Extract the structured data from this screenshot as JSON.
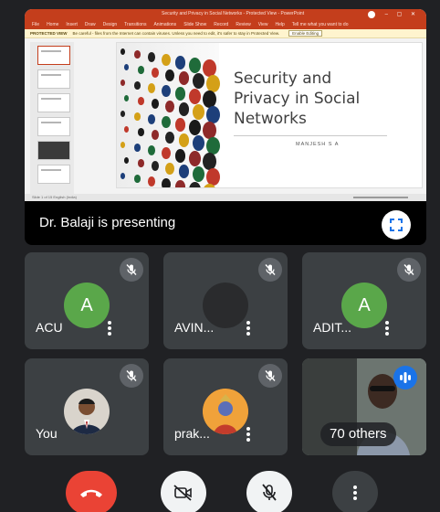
{
  "powerpoint": {
    "window_title": "Security and Privacy in Social Networks - Protected View - PowerPoint",
    "ribbon_tabs": [
      "File",
      "Home",
      "Insert",
      "Draw",
      "Design",
      "Transitions",
      "Animations",
      "Slide Show",
      "Record",
      "Review",
      "View",
      "Help",
      "Tell me what you want to do"
    ],
    "protected_view_label": "PROTECTED VIEW",
    "protected_view_text": "Be careful - files from the Internet can contain viruses. Unless you need to edit, it's safer to stay in Protected View.",
    "enable_editing_label": "Enable Editing",
    "status_text": "Slide 1 of 15   English (India)",
    "slide": {
      "title": "Security and\nPrivacy in Social\nNetworks",
      "author": "MANJESH S A"
    }
  },
  "presenter_banner": "Dr. Balaji is presenting",
  "tiles": [
    {
      "name": "ACU",
      "initial": "A",
      "avatar_color": "#5aa74a"
    },
    {
      "name": "AVIN...",
      "initial": "",
      "avatar_color": "#2a2b2d"
    },
    {
      "name": "ADIT...",
      "initial": "A",
      "avatar_color": "#5aa74a"
    },
    {
      "name": "You",
      "initial": ""
    },
    {
      "name": "prak...",
      "initial": ""
    },
    {
      "name": "70 others"
    }
  ],
  "colors": {
    "background": "#202124",
    "tile": "#3c4043",
    "hangup": "#ea4335",
    "accent_blue": "#1a73e8",
    "powerpoint_red": "#c43e1c"
  },
  "icons": {
    "fullscreen": "fullscreen-icon",
    "mic_muted": "mic-off-icon",
    "camera_off": "camera-off-icon",
    "hangup": "phone-hangup-icon",
    "more": "more-vert-icon",
    "speaking": "audio-level-icon"
  }
}
